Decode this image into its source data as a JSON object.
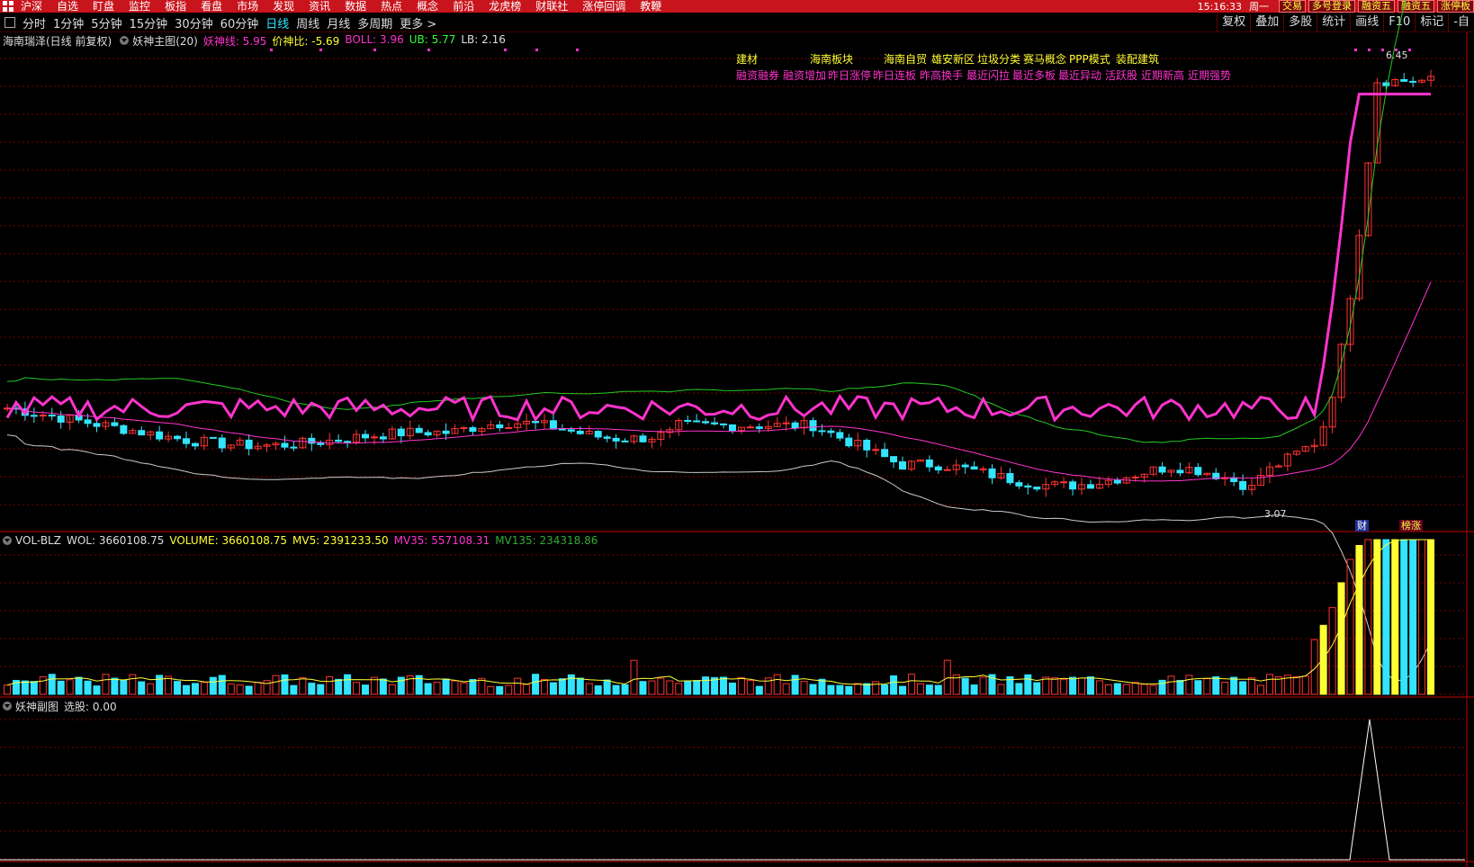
{
  "menubar": {
    "items": [
      "沪深",
      "自选",
      "盯盘",
      "监控",
      "板指",
      "看盘",
      "市场",
      "发现",
      "资讯",
      "数据",
      "热点",
      "概念",
      "前沿",
      "龙虎榜",
      "财联社",
      "涨停回调",
      "教鞭"
    ],
    "clock": "15:16:33",
    "weekday": "周一",
    "buttons": [
      "交易",
      "多号登录",
      "融资五",
      "融资五",
      "涨停板"
    ]
  },
  "toolbar": {
    "periods": [
      "分时",
      "1分钟",
      "5分钟",
      "15分钟",
      "30分钟",
      "60分钟",
      "日线",
      "周线",
      "月线",
      "多周期",
      "更多 >"
    ],
    "active_period": "日线",
    "right_buttons": [
      "复权",
      "叠加",
      "多股",
      "统计",
      "画线",
      "F10",
      "标记",
      "-自"
    ]
  },
  "main_pane": {
    "stock_title": "海南瑞泽(日线 前复权)",
    "indicator_name": "妖神主图(20)",
    "labels": [
      {
        "text": "妖神线: 5.95",
        "color": "#ff33cc"
      },
      {
        "text": "价神比: -5.69",
        "color": "#ffff33"
      },
      {
        "text": "BOLL: 3.96",
        "color": "#ff33cc"
      },
      {
        "text": "UB: 5.77",
        "color": "#33ff33"
      },
      {
        "text": "LB: 2.16",
        "color": "#dddddd"
      }
    ],
    "concepts_line1": [
      "建材",
      "海南板块",
      "海南自贸",
      "雄安新区",
      "垃圾分类",
      "赛马概念",
      "PPP模式",
      "装配建筑"
    ],
    "concepts_line2": [
      "融资融券",
      "融资增加",
      "昨日涨停",
      "昨日连板",
      "昨高换手",
      "最近闪拉",
      "最近多板",
      "最近异动",
      "活跃股",
      "近期新高",
      "近期强势"
    ],
    "high_label": "6.45",
    "low_label": "3.07",
    "tag_cai": "财",
    "tag_bang": "榜涨"
  },
  "vol_pane": {
    "name": "VOL-BLZ",
    "labels": [
      {
        "text": "WOL: 3660108.75",
        "color": "#dddddd"
      },
      {
        "text": "VOLUME: 3660108.75",
        "color": "#ffff33"
      },
      {
        "text": "MV5: 2391233.50",
        "color": "#ffff33"
      },
      {
        "text": "MV35: 557108.31",
        "color": "#ff33cc"
      },
      {
        "text": "MV135: 234318.86",
        "color": "#33aa33"
      }
    ]
  },
  "sub_pane": {
    "name": "妖神副图",
    "labels": [
      {
        "text": "选股: 0.00",
        "color": "#dddddd"
      }
    ]
  },
  "colors": {
    "up": "#ff3333",
    "down": "#33e4ff",
    "boll_mid": "#ff33cc",
    "boll_up": "#22cc22",
    "boll_low": "#cccccc",
    "yao": "#ff33cc",
    "grid": "#7a0000"
  },
  "chart_data": {
    "type": "candlestick",
    "ylim": [
      3.0,
      6.5
    ],
    "y_marks": {
      "high": 6.45,
      "low": 3.07
    },
    "candles_seed": "approx. 160 daily bars; low consolidation 3.3–4.0 then vertical rally to 6.45"
  }
}
